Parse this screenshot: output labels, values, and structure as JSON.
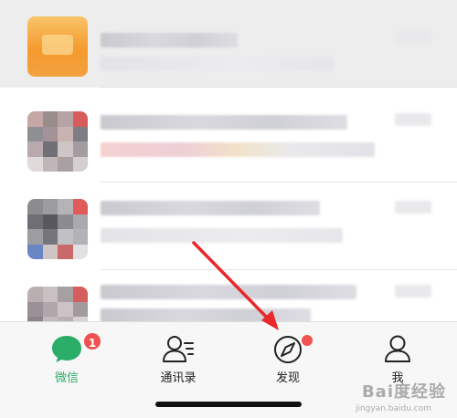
{
  "tabs": [
    {
      "label": "微信",
      "icon": "chat-bubble-icon",
      "badge": "1",
      "active": true
    },
    {
      "label": "通讯录",
      "icon": "contacts-icon"
    },
    {
      "label": "发现",
      "icon": "compass-icon",
      "dot": true
    },
    {
      "label": "我",
      "icon": "person-icon"
    }
  ],
  "watermark": {
    "text": "Bai度经验",
    "sub": "jingyan.baidu.com"
  },
  "colors": {
    "accent": "#2aae67",
    "badge": "#f05252",
    "arrow": "#e8282b"
  }
}
